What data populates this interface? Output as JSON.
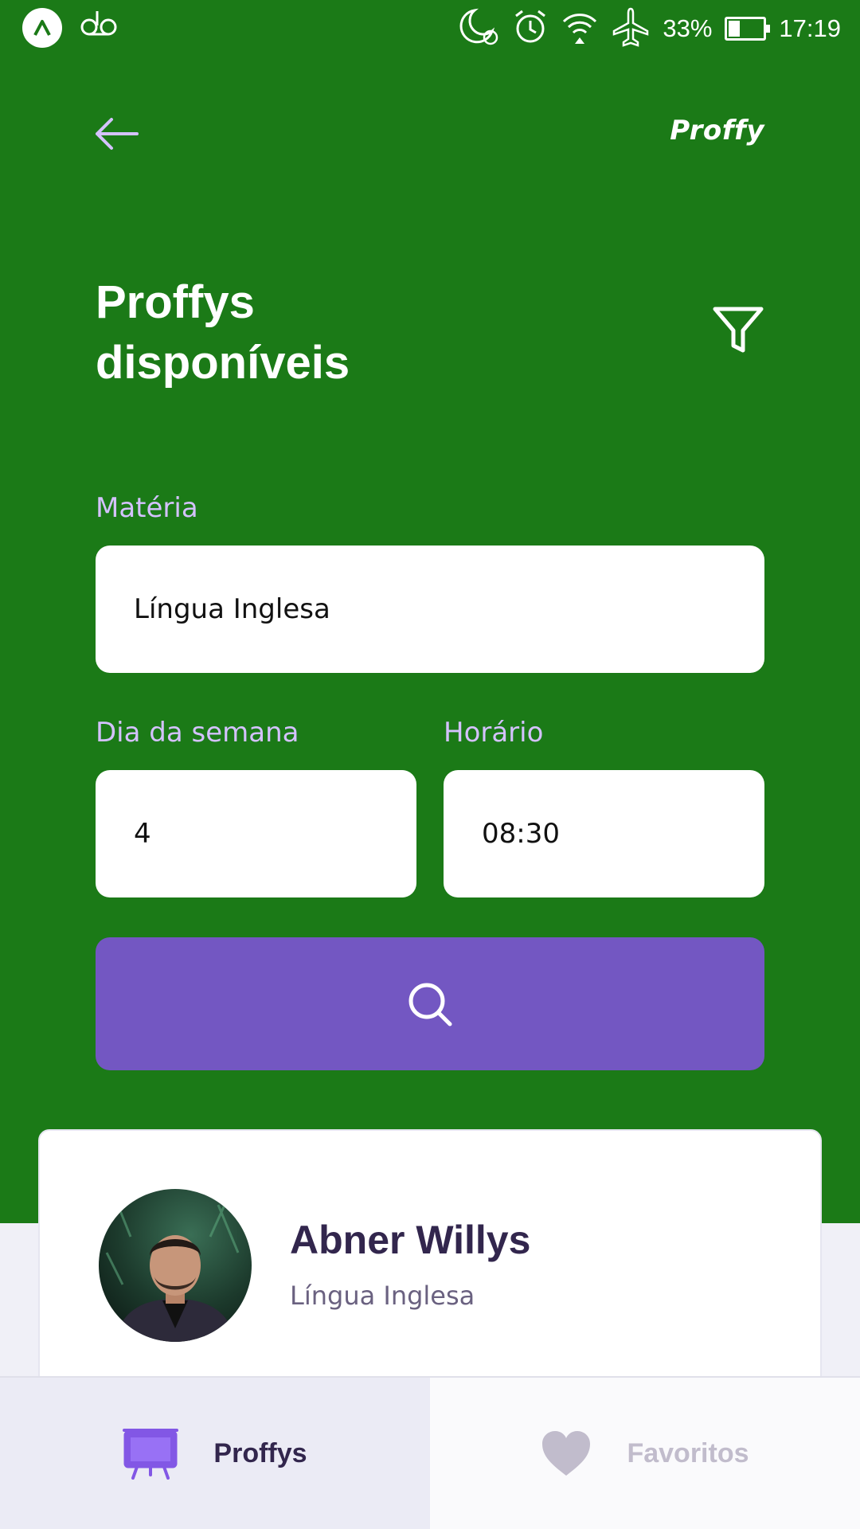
{
  "status_bar": {
    "battery_percent_label": "33%",
    "battery_level": 0.33,
    "time": "17:19",
    "icons": [
      "app-logo-icon",
      "voicemail-icon",
      "do-not-disturb-icon",
      "alarm-icon",
      "wifi-icon",
      "airplane-mode-icon",
      "battery-icon"
    ]
  },
  "topbar": {
    "brand": "Proffy",
    "back_icon": "arrow-left-icon"
  },
  "page": {
    "title_line1": "Proffys",
    "title_line2": "disponíveis",
    "filter_icon": "filter-icon"
  },
  "filters": {
    "subject_label": "Matéria",
    "subject_value": "Língua Inglesa",
    "weekday_label": "Dia da semana",
    "weekday_value": "4",
    "time_label": "Horário",
    "time_value": "08:30",
    "search_icon": "search-icon"
  },
  "teacher_card": {
    "name": "Abner Willys",
    "subject": "Língua Inglesa"
  },
  "tabs": [
    {
      "label": "Proffys",
      "icon": "easel-icon",
      "active": true
    },
    {
      "label": "Favoritos",
      "icon": "heart-icon",
      "active": false
    }
  ],
  "colors": {
    "header_bg": "#1b7a17",
    "primary": "#7357c2",
    "label": "#d4c2ff",
    "title_dark": "#32264d",
    "tab_inactive": "#c1bccc"
  }
}
